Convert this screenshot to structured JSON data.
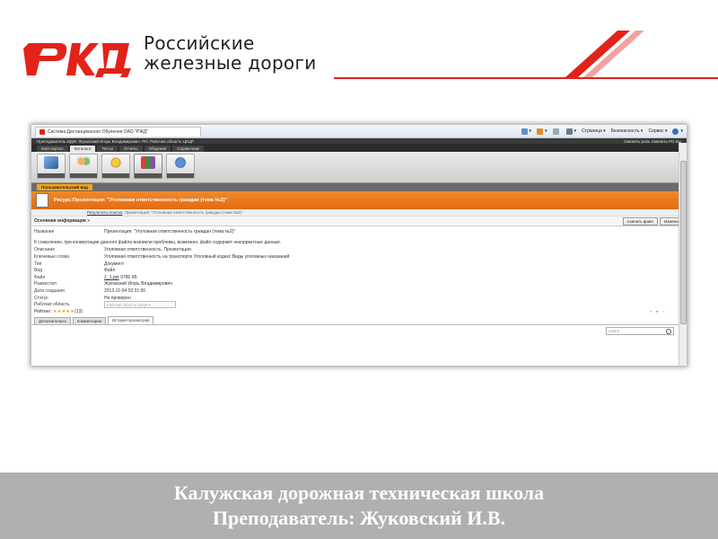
{
  "brand": {
    "line1": "Российские",
    "line2": "железные дороги",
    "logo_name": "rzd-logo",
    "accent_color": "#e2231a"
  },
  "browser": {
    "tab_title": "Система Дистанционного Обучения ОАО \"РЖД\"",
    "commands": [
      "Страница",
      "Безопасность",
      "Сервис"
    ]
  },
  "app": {
    "user_line": "Преподаватель ИДЖ: Жуковский Игорь Владимирович. РО: Рабочая область ЦКЦР",
    "right_links": "Сменить роль Сменить РО Вы",
    "nav_tabs": [
      "Мой портал",
      "Каталоги",
      "Тесты",
      "Отчеты",
      "Общение",
      "Справочник"
    ],
    "toolbar_icons": [
      {
        "name": "cube-icon",
        "color": "#4a7fc0"
      },
      {
        "name": "users-icon",
        "color": "#d9822b"
      },
      {
        "name": "award-icon",
        "color": "#d4a017"
      },
      {
        "name": "books-icon",
        "color": "#8a4fb0"
      },
      {
        "name": "info-icon",
        "color": "#3a6fb8"
      }
    ],
    "view_label": "Пользовательский вид",
    "resource_title": "Ресурс:Презентация: \"Уголовная ответственность граждан (тема №2)\"",
    "breadcrumb_link": "Результаты поиска",
    "breadcrumb_rest": " : Презентация: \"Уголовная ответственность граждан (тема №2)\"",
    "info_header": "Основная информация »",
    "download_btn": "Скачать файл",
    "replace_btn": "Изменит",
    "name_label": "Название",
    "name_value": "Презентация: \"Уголовная ответственность граждан (тема №2)\"",
    "warning": "К сожалению, при конвертации данного файла возникли проблемы, возможно, файл содержит некорректные данные.",
    "details": [
      {
        "k": "Описание",
        "v": "Уголовная ответственность. Презентация."
      },
      {
        "k": "Ключевые слова",
        "v": "Уголовная ответственность на транспорте Уголовный кодекс Виды уголовных наказаний"
      },
      {
        "k": "Тип",
        "v": "Документ"
      },
      {
        "k": "Вид",
        "v": "Файл"
      }
    ],
    "file_label": "Файл",
    "file_link": "2_3.ppt",
    "file_size": " 9786 КБ",
    "details2": [
      {
        "k": "Разместил",
        "v": "Жуковский Игорь Владимирович"
      },
      {
        "k": "Дата создания",
        "v": "2012-11-04 02:31:56"
      },
      {
        "k": "Статус",
        "v": "Не проверен"
      }
    ],
    "area_label": "Рабочая область",
    "area_value": "Рабочая область ЦКЦР",
    "rating_label": "Рейтинг:",
    "rating_stars": "★★★★★",
    "rating_count": "(13)",
    "bottom_tabs": [
      "Дополнительно",
      "Комментарии",
      "История просмотров"
    ],
    "search_placeholder": "Найти"
  },
  "footer": {
    "line1": "Калужская дорожная техническая школа",
    "line2": "Преподаватель: Жуковский И.В."
  }
}
